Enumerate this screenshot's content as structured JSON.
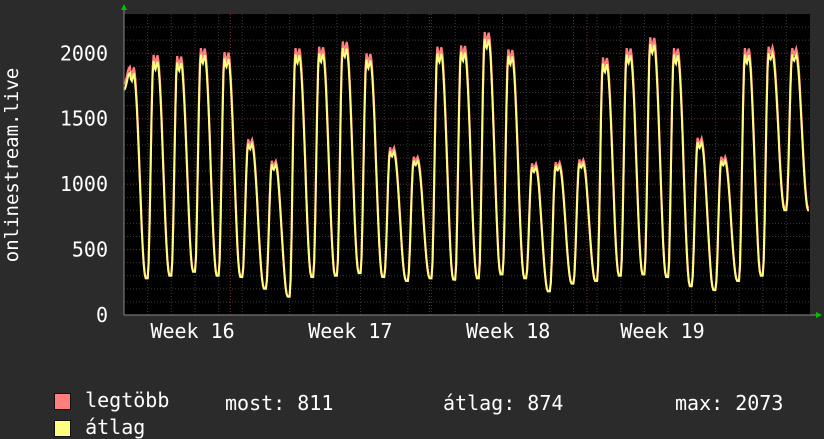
{
  "chart_data": {
    "type": "line",
    "ylabel": "onlinestream.live",
    "ylim": [
      0,
      2300
    ],
    "yticks": [
      0,
      500,
      1000,
      1500,
      2000
    ],
    "xticks": [
      "Week 16",
      "Week 17",
      "Week 18",
      "Week 19"
    ],
    "grid": true,
    "series": [
      {
        "name": "legtöbb",
        "color": "#ff7f7f"
      },
      {
        "name": "átlag",
        "color": "#ffff7f"
      }
    ],
    "daily_peaks": [
      1850,
      1940,
      1930,
      1990,
      1960,
      1310,
      1150,
      1990,
      2000,
      2040,
      1950,
      1250,
      1180,
      2000,
      2010,
      2110,
      1980,
      1130,
      1140,
      1160,
      1920,
      1990,
      2070,
      1990,
      1320,
      1180,
      1990,
      2000,
      1990
    ],
    "daily_troughs": [
      1720,
      280,
      300,
      330,
      300,
      290,
      200,
      140,
      290,
      300,
      320,
      290,
      260,
      280,
      270,
      280,
      310,
      280,
      180,
      240,
      260,
      300,
      310,
      290,
      220,
      190,
      260,
      300,
      800
    ],
    "stats": {
      "most": "811",
      "atlag": "874",
      "max": "2073"
    }
  },
  "legend": [
    {
      "label": "legtöbb",
      "color": "#ff7f7f"
    },
    {
      "label": "átlag",
      "color": "#ffff7f"
    }
  ],
  "stats_text": {
    "most": "most: 811",
    "atlag": "átlag: 874",
    "max": "max: 2073"
  }
}
